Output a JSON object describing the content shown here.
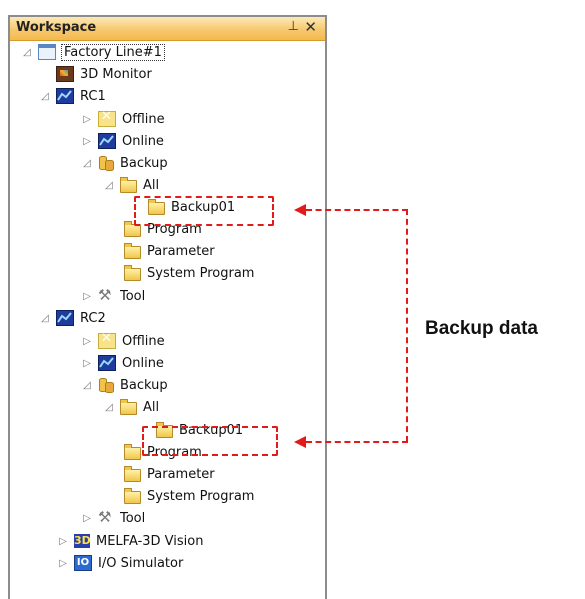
{
  "workspace": {
    "title": "Workspace",
    "pin_glyph": "ᵖ",
    "close_glyph": "✕"
  },
  "tree": {
    "root": "Factory Line#1",
    "monitor": "3D Monitor",
    "rc1": {
      "label": "RC1",
      "offline": "Offline",
      "online": "Online",
      "backup": "Backup",
      "all": "All",
      "backup_item": "Backup01",
      "program": "Program",
      "parameter": "Parameter",
      "system_program": "System Program",
      "tool": "Tool"
    },
    "rc2": {
      "label": "RC2",
      "offline": "Offline",
      "online": "Online",
      "backup": "Backup",
      "all": "All",
      "backup_item": "Backup01",
      "program": "Program",
      "parameter": "Parameter",
      "system_program": "System Program",
      "tool": "Tool"
    },
    "vision": "MELFA-3D Vision",
    "io_sim": "I/O Simulator",
    "vision_icon_text": "3D",
    "io_icon_text": "IO"
  },
  "callout": "Backup data",
  "colors": {
    "annotation": "#e31a1a",
    "titlebar": "#f7c870"
  }
}
